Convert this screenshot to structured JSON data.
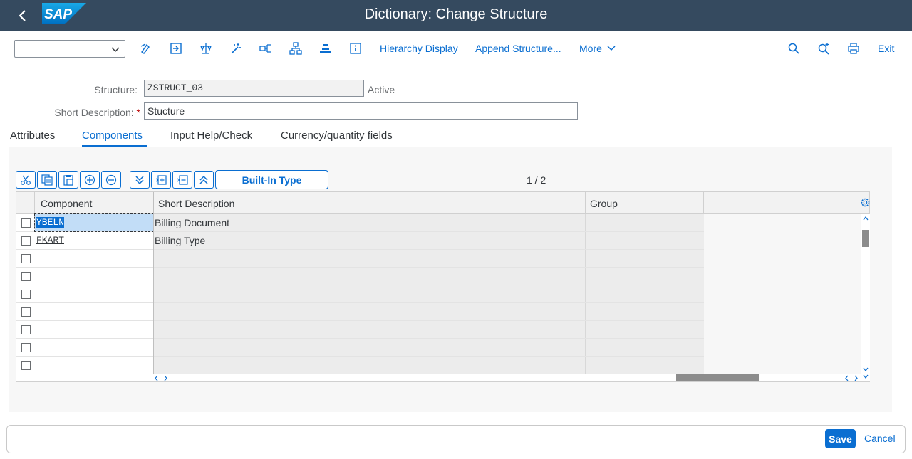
{
  "shell": {
    "title": "Dictionary: Change Structure",
    "logo_text": "SAP"
  },
  "toolbar": {
    "dropdown_value": "",
    "hierarchy_label": "Hierarchy Display",
    "append_label": "Append Structure...",
    "more_label": "More",
    "exit_label": "Exit"
  },
  "form": {
    "structure_label": "Structure:",
    "structure_value": "ZSTRUCT_03",
    "status": "Active",
    "desc_label": "Short Description:",
    "required_mark": "*",
    "desc_value": "Stucture"
  },
  "tabs": [
    "Attributes",
    "Components",
    "Input Help/Check",
    "Currency/quantity fields"
  ],
  "grid": {
    "builtin_label": "Built-In Type",
    "pager": "1  /  2",
    "columns": [
      "Component",
      "Short Description",
      "Group"
    ],
    "rows": [
      {
        "component": "YBELN",
        "description": "Billing Document",
        "group": ""
      },
      {
        "component": "FKART",
        "description": "Billing Type",
        "group": ""
      },
      {
        "component": "",
        "description": "",
        "group": ""
      },
      {
        "component": "",
        "description": "",
        "group": ""
      },
      {
        "component": "",
        "description": "",
        "group": ""
      },
      {
        "component": "",
        "description": "",
        "group": ""
      },
      {
        "component": "",
        "description": "",
        "group": ""
      },
      {
        "component": "",
        "description": "",
        "group": ""
      },
      {
        "component": "",
        "description": "",
        "group": ""
      }
    ]
  },
  "footer": {
    "save_label": "Save",
    "cancel_label": "Cancel"
  },
  "colors": {
    "shell_bg": "#354a5f",
    "accent": "#0a6ed1",
    "selection": "#c2ddf7"
  }
}
